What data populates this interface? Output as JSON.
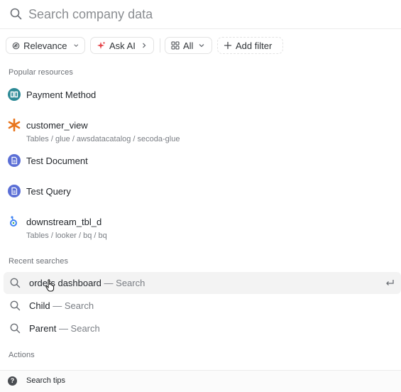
{
  "search": {
    "placeholder": "Search company data",
    "value": ""
  },
  "filters": {
    "relevance": "Relevance",
    "ask_ai": "Ask AI",
    "all": "All",
    "add_filter": "Add filter"
  },
  "popular": {
    "title": "Popular resources",
    "items": [
      {
        "name": "Payment Method",
        "path": "",
        "icon": "book-icon"
      },
      {
        "name": "customer_view",
        "path": "Tables / glue / awsdatacatalog / secoda-glue",
        "icon": "aws-glue-icon"
      },
      {
        "name": "Test Document",
        "path": "",
        "icon": "document-icon"
      },
      {
        "name": "Test Query",
        "path": "",
        "icon": "document-icon"
      },
      {
        "name": "downstream_tbl_d",
        "path": "Tables / looker / bq / bq",
        "icon": "looker-icon"
      }
    ]
  },
  "recent": {
    "title": "Recent searches",
    "items": [
      {
        "query": "orders dashboard",
        "suffix": "— Search"
      },
      {
        "query": "Child",
        "suffix": "— Search"
      },
      {
        "query": "Parent",
        "suffix": "— Search"
      }
    ]
  },
  "actions": {
    "title": "Actions",
    "search_tips": "Search tips"
  },
  "colors": {
    "book_teal": "#2d8a96",
    "doc_blue": "#5b6fd6",
    "glue_orange": "#e8741c",
    "looker_blue": "#4285f4",
    "ai_red": "#e5484d"
  }
}
